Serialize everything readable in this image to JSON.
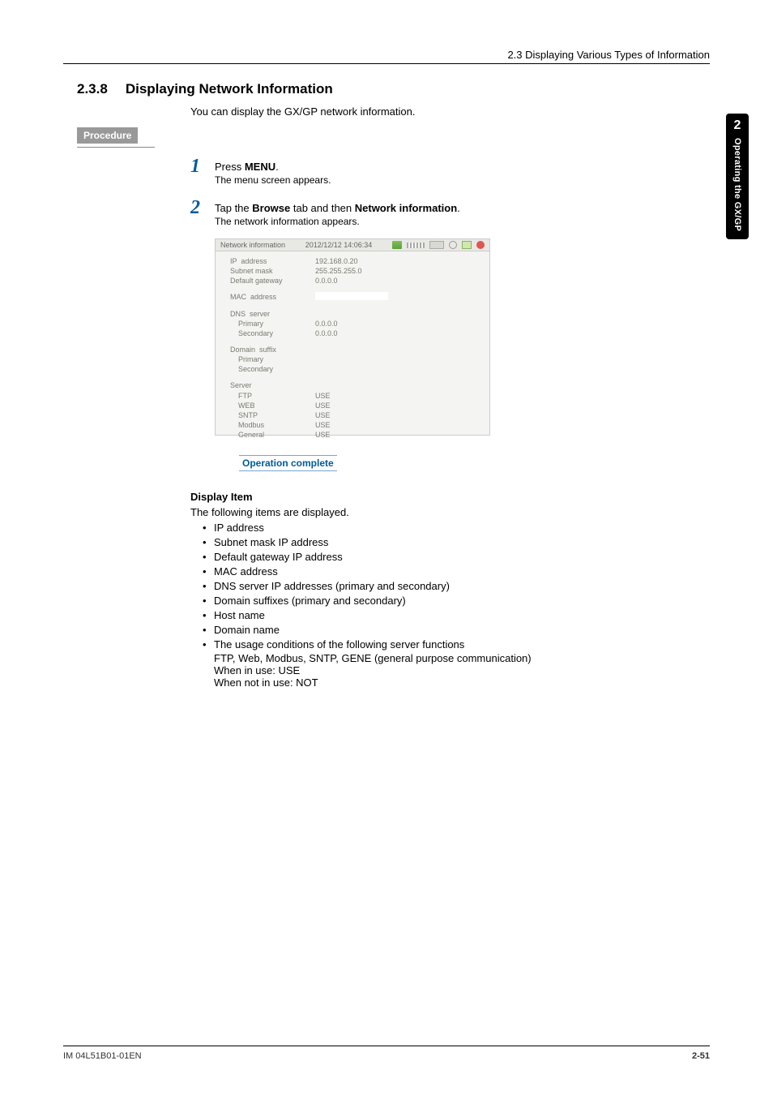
{
  "header": {
    "breadcrumb": "2.3  Displaying Various Types of Information"
  },
  "side_tab": {
    "num": "2",
    "text": "Operating the GX/GP"
  },
  "section": {
    "number": "2.3.8",
    "title": "Displaying Network Information"
  },
  "intro": "You can display the GX/GP network information.",
  "procedure_label": "  Procedure  ",
  "steps": [
    {
      "num": "1",
      "line": "Press MENU.",
      "sub": "The menu screen appears.",
      "bold_word": "MENU"
    },
    {
      "num": "2",
      "line": "Tap the Browse tab and then Network information.",
      "sub": "The network information appears.",
      "bold1": "Browse",
      "bold2": "Network information"
    }
  ],
  "device_screen": {
    "title": "Network information",
    "datetime": "2012/12/12 14:06:34",
    "rows": {
      "ip_label": "IP  address",
      "ip_value": "192.168.0.20",
      "mask_label": "Subnet mask",
      "mask_value": "255.255.255.0",
      "gw_label": "Default gateway",
      "gw_value": "0.0.0.0",
      "mac_label": "MAC  address",
      "dns_header": "DNS  server",
      "dns_pri_label": "Primary",
      "dns_pri_value": "0.0.0.0",
      "dns_sec_label": "Secondary",
      "dns_sec_value": "0.0.0.0",
      "suffix_header": "Domain  suffix",
      "suffix_pri_label": "Primary",
      "suffix_sec_label": "Secondary",
      "server_header": "Server",
      "ftp_label": "FTP",
      "ftp_value": "USE",
      "web_label": "WEB",
      "web_value": "USE",
      "sntp_label": "SNTP",
      "sntp_value": "USE",
      "modbus_label": "Modbus",
      "modbus_value": "USE",
      "general_label": "General",
      "general_value": "USE"
    }
  },
  "op_complete": "Operation complete",
  "display_item": {
    "heading": "Display Item",
    "lead": "The following items are displayed.",
    "bullets": [
      "IP address",
      "Subnet mask IP address",
      "Default gateway IP address",
      "MAC address",
      "DNS server IP addresses (primary and secondary)",
      "Domain suffixes (primary and secondary)",
      "Host name",
      "Domain name"
    ],
    "last_bullet": "The usage conditions of the following server functions",
    "last_lines": [
      "FTP, Web, Modbus, SNTP, GENE (general purpose communication)",
      "When in use: USE",
      "When not in use: NOT"
    ]
  },
  "footer": {
    "left": "IM 04L51B01-01EN",
    "right": "2-51"
  }
}
